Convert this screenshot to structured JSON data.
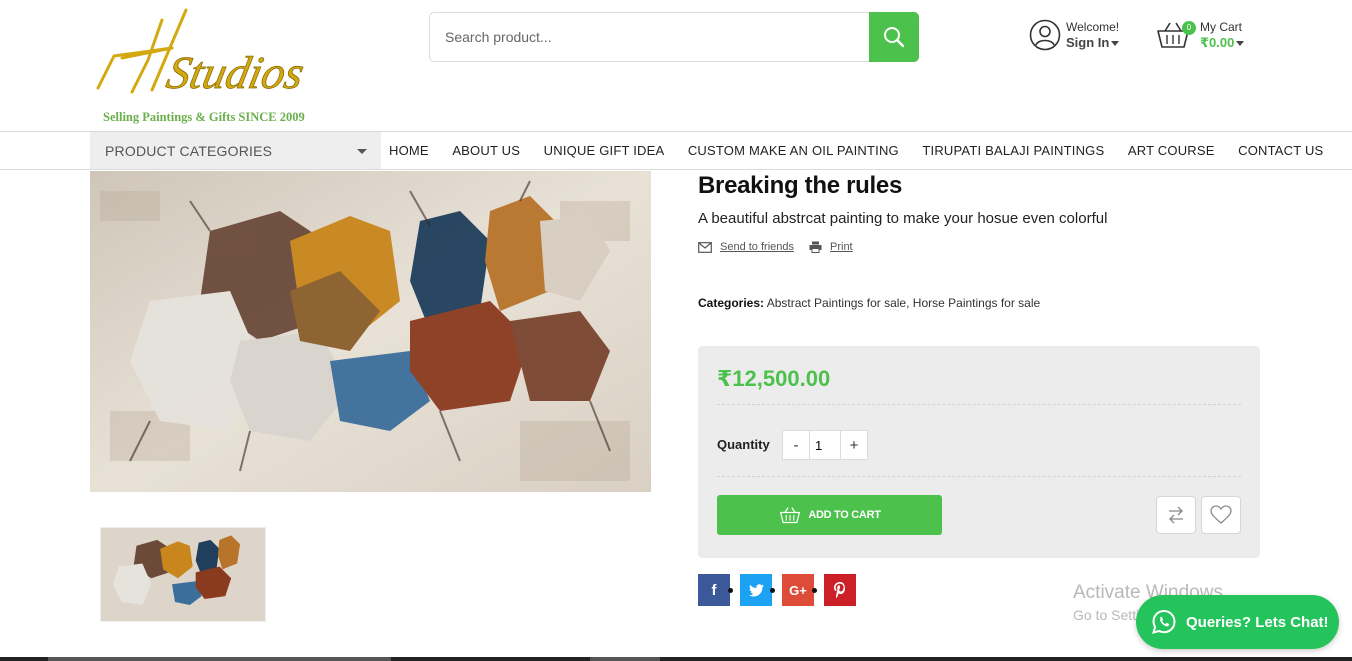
{
  "header": {
    "logo_tagline": "Selling Paintings & Gifts SINCE 2009",
    "search": {
      "placeholder": "Search product..."
    },
    "account": {
      "greeting": "Welcome!",
      "action": "Sign In"
    },
    "cart": {
      "label": "My Cart",
      "total": "₹0.00",
      "count": "0"
    }
  },
  "nav": {
    "categories_label": "PRODUCT CATEGORIES",
    "menu": [
      "HOME",
      "ABOUT US",
      "UNIQUE GIFT IDEA",
      "CUSTOM MAKE AN OIL PAINTING",
      "TIRUPATI BALAJI PAINTINGS",
      "ART COURSE",
      "CONTACT US"
    ]
  },
  "product": {
    "title": "Breaking the rules",
    "subtitle": "A beautiful abstrcat painting to make your hosue even colorful",
    "send_to_friends": "Send to friends",
    "print": "Print",
    "categories_label": "Categories:",
    "categories": [
      "Abstract Paintings for sale",
      "Horse Paintings for sale"
    ],
    "category_separator": ",",
    "price": "₹12,500.00",
    "quantity_label": "Quantity",
    "quantity_minus": "-",
    "quantity_plus": "+",
    "quantity_value": "1",
    "add_to_cart": "ADD TO CART"
  },
  "social": {
    "facebook": "f",
    "google": "G+"
  },
  "overlay": {
    "activate_title": "Activate Windows",
    "activate_sub": "Go to Settings to activate Windows.",
    "chat_label": "Queries? Lets Chat!"
  },
  "colors": {
    "accent_green": "#4cc14c",
    "facebook": "#3b5998",
    "twitter": "#1da1f2",
    "google": "#dd4b39",
    "pinterest": "#cb2027",
    "whatsapp": "#25c35c"
  }
}
